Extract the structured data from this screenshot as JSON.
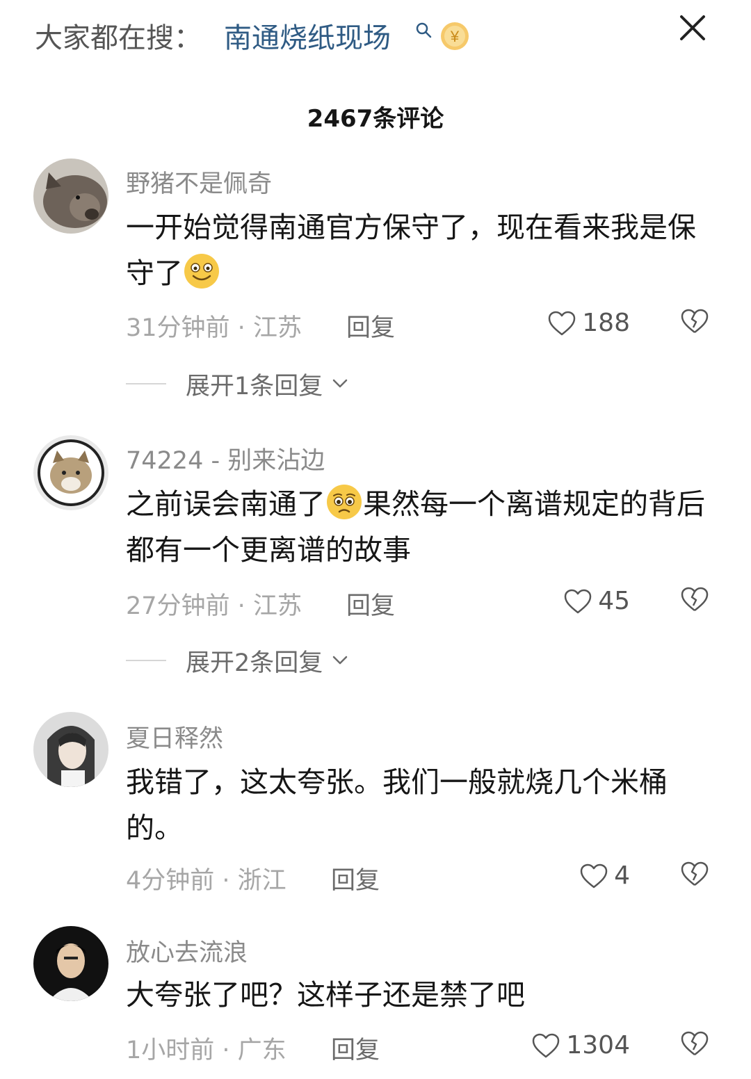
{
  "top": {
    "search_prefix": "大家都在搜：",
    "search_term": "南通烧纸现场",
    "coin_symbol": "¥"
  },
  "comments_header": "2467条评论",
  "comments": [
    {
      "username": "野猪不是佩奇",
      "text_before": "一开始觉得南通官方保守了，现在看来我是保守了",
      "emoji": "smile-emoji",
      "text_after": "",
      "time": "31分钟前",
      "location": "江苏",
      "reply": "回复",
      "likes": "188",
      "expand": "展开1条回复"
    },
    {
      "username": "74224 - 别来沾边",
      "text_before": "之前误会南通了",
      "emoji": "pleading-emoji",
      "text_after": "果然每一个离谱规定的背后都有一个更离谱的故事",
      "time": "27分钟前",
      "location": "江苏",
      "reply": "回复",
      "likes": "45",
      "expand": "展开2条回复"
    },
    {
      "username": "夏日释然",
      "text_before": "我错了，这太夸张。我们一般就烧几个米桶的。",
      "emoji": "",
      "text_after": "",
      "time": "4分钟前",
      "location": "浙江",
      "reply": "回复",
      "likes": "4",
      "expand": ""
    },
    {
      "username": "放心去流浪",
      "text_before": "大夸张了吧？这样子还是禁了吧",
      "emoji": "",
      "text_after": "",
      "time": "1小时前",
      "location": "广东",
      "reply": "回复",
      "likes": "1304",
      "expand": ""
    }
  ],
  "meta_separator": " · ",
  "colors": {
    "search_term": "#2f5b84",
    "muted_text": "#8a8a8a",
    "body_text": "#161616",
    "emoji_yellow": "#f7c948"
  }
}
